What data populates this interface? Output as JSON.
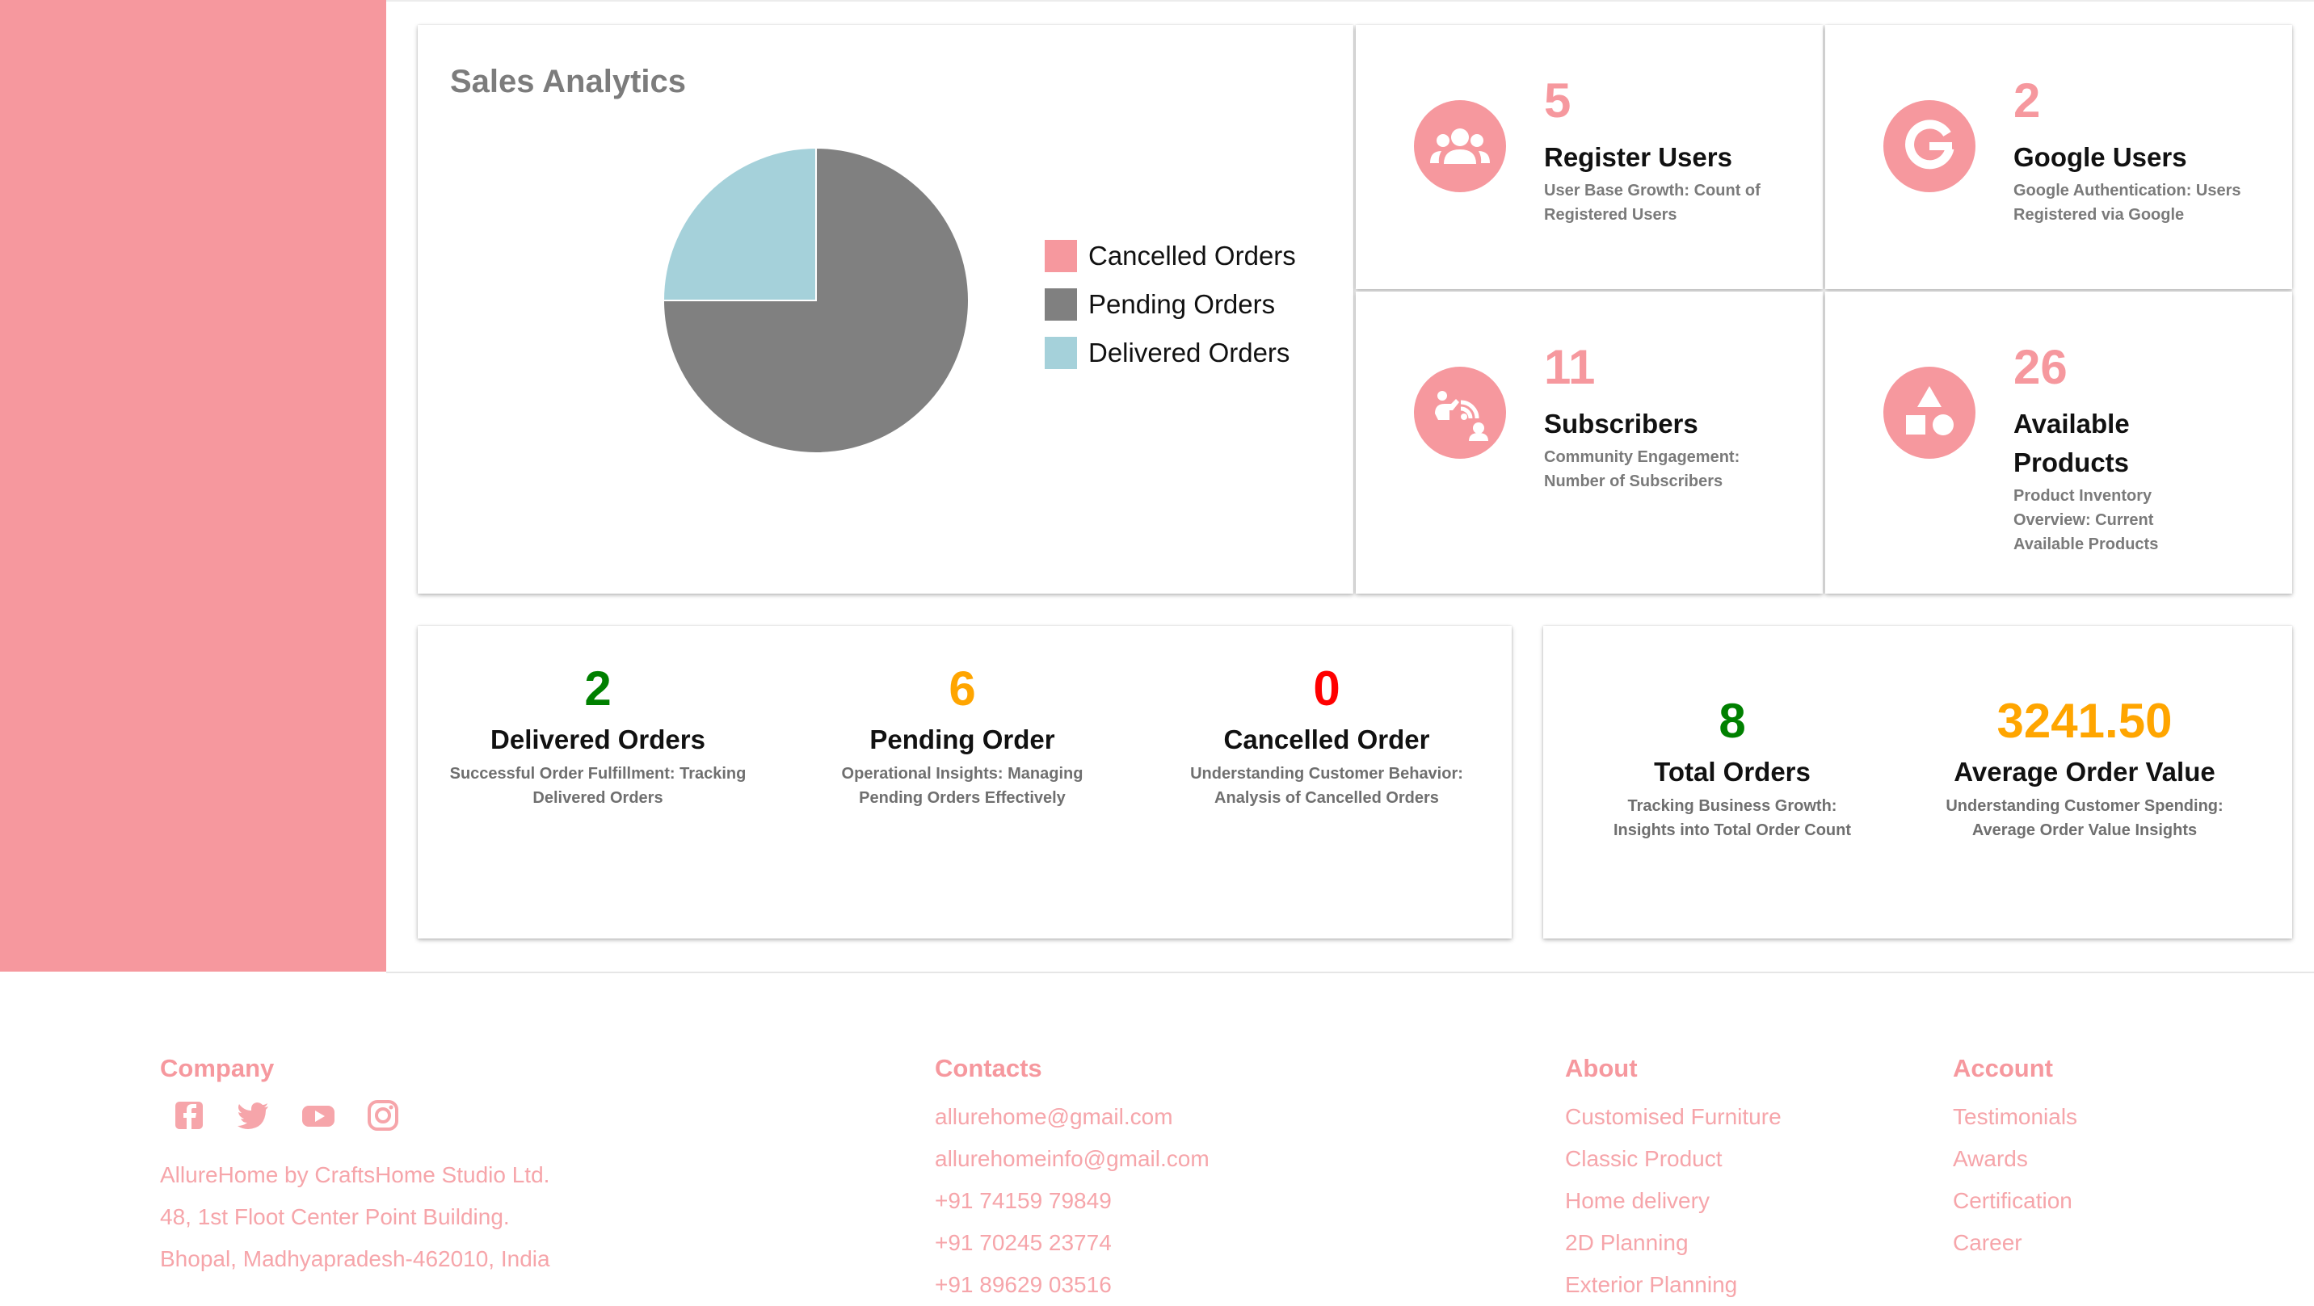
{
  "colors": {
    "accent": "#f6989e",
    "cancelled": "#f6989e",
    "pending": "#808080",
    "delivered": "#a5d1da",
    "green": "#008000",
    "orange": "#ffa500",
    "red": "#ff0000"
  },
  "sales": {
    "title": "Sales Analytics"
  },
  "chart_data": {
    "type": "pie",
    "title": "Sales Analytics",
    "legend_position": "right",
    "categories": [
      "Cancelled Orders",
      "Pending Orders",
      "Delivered Orders"
    ],
    "values": [
      0,
      6,
      2
    ],
    "colors": [
      "#f6989e",
      "#808080",
      "#a5d1da"
    ]
  },
  "stats": [
    {
      "number": "5",
      "label": "Register Users",
      "desc": "User Base Growth: Count of Registered Users",
      "icon": "users-icon"
    },
    {
      "number": "2",
      "label": "Google Users",
      "desc": "Google Authentication: Users Registered via Google",
      "icon": "google-icon"
    },
    {
      "number": "11",
      "label": "Subscribers",
      "desc": "Community Engagement: Number of Subscribers",
      "icon": "subscribers-icon"
    },
    {
      "number": "26",
      "label": "Available Products",
      "desc": "Product Inventory Overview: Current Available Products",
      "icon": "shapes-icon"
    }
  ],
  "orders": [
    {
      "number": "2",
      "label": "Delivered Orders",
      "desc": "Successful Order Fulfillment: Tracking Delivered Orders",
      "color": "#008000"
    },
    {
      "number": "6",
      "label": "Pending Order",
      "desc": "Operational Insights: Managing Pending Orders Effectively",
      "color": "#ffa500"
    },
    {
      "number": "0",
      "label": "Cancelled Order",
      "desc": "Understanding Customer Behavior: Analysis of Cancelled Orders",
      "color": "#ff0000"
    }
  ],
  "totals": [
    {
      "number": "8",
      "label": "Total Orders",
      "desc": "Tracking Business Growth: Insights into Total Order Count",
      "color": "#008000"
    },
    {
      "number": "3241.50",
      "label": "Average Order Value",
      "desc": "Understanding Customer Spending: Average Order Value Insights",
      "color": "#ffa500"
    }
  ],
  "footer": {
    "company": {
      "heading": "Company",
      "social": [
        "facebook-icon",
        "twitter-icon",
        "youtube-icon",
        "instagram-icon"
      ],
      "lines": [
        "AllureHome by CraftsHome Studio Ltd.",
        "48, 1st Floot Center Point Building.",
        "Bhopal, Madhyapradesh-462010, India"
      ]
    },
    "contacts": {
      "heading": "Contacts",
      "items": [
        "allurehome@gmail.com",
        "allurehomeinfo@gmail.com",
        "+91 74159 79849",
        "+91 70245 23774",
        "+91 89629 03516"
      ]
    },
    "about": {
      "heading": "About",
      "items": [
        "Customised Furniture",
        "Classic Product",
        "Home delivery",
        "2D Planning",
        "Exterior Planning"
      ]
    },
    "account": {
      "heading": "Account",
      "items": [
        "Testimonials",
        "Awards",
        "Certification",
        "Career"
      ]
    }
  }
}
